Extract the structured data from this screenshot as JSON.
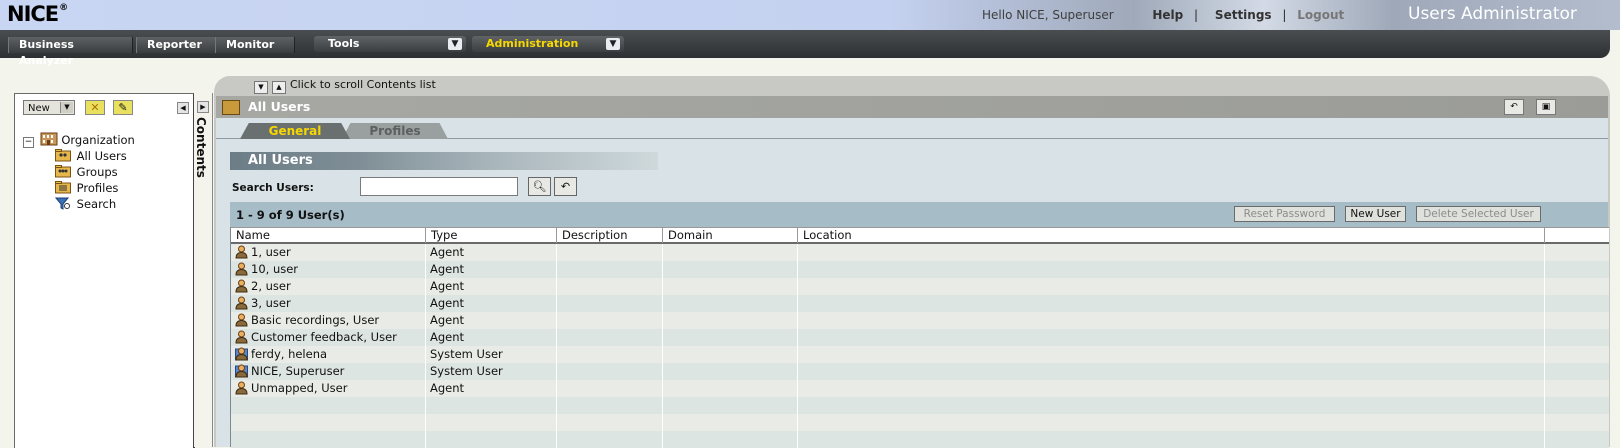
{
  "header": {
    "logo": "NICE",
    "logo_mark": "®",
    "greeting": "Hello NICE, Superuser",
    "links": [
      "Help",
      "Settings",
      "Logout"
    ],
    "app_title": "Users Administrator"
  },
  "nav": {
    "tabs": [
      "Business Analyzer",
      "Reporter",
      "Monitor"
    ],
    "tools_label": "Tools",
    "admin_label": "Administration"
  },
  "left": {
    "new_label": "New",
    "tree": [
      {
        "label": "Organization",
        "icon": "building-icon"
      },
      {
        "label": "All Users",
        "icon": "users-folder-icon"
      },
      {
        "label": "Groups",
        "icon": "groups-folder-icon"
      },
      {
        "label": "Profiles",
        "icon": "profiles-folder-icon"
      },
      {
        "label": "Search",
        "icon": "search-filter-icon"
      }
    ],
    "contents_label": "Contents"
  },
  "main": {
    "scroll_hint": "Click to scroll Contents list",
    "title": "All Users",
    "tabs": [
      "General",
      "Profiles"
    ],
    "section_title": "All Users",
    "search_label": "Search Users:",
    "search_value": "",
    "count_text": "1 - 9 of 9 User(s)",
    "buttons": {
      "reset": "Reset Password",
      "new_user": "New User",
      "delete": "Delete Selected User"
    },
    "columns": [
      "Name",
      "Type",
      "Description",
      "Domain",
      "Location"
    ],
    "rows": [
      {
        "name": "1, user",
        "type": "Agent",
        "description": "",
        "domain": "",
        "location": "",
        "icon": "agent-icon"
      },
      {
        "name": "10, user",
        "type": "Agent",
        "description": "",
        "domain": "",
        "location": "",
        "icon": "agent-icon"
      },
      {
        "name": "2, user",
        "type": "Agent",
        "description": "",
        "domain": "",
        "location": "",
        "icon": "agent-icon"
      },
      {
        "name": "3, user",
        "type": "Agent",
        "description": "",
        "domain": "",
        "location": "",
        "icon": "agent-icon"
      },
      {
        "name": "Basic recordings, User",
        "type": "Agent",
        "description": "",
        "domain": "",
        "location": "",
        "icon": "agent-icon"
      },
      {
        "name": "Customer feedback, User",
        "type": "Agent",
        "description": "",
        "domain": "",
        "location": "",
        "icon": "agent-icon"
      },
      {
        "name": "ferdy, helena",
        "type": "System User",
        "description": "",
        "domain": "",
        "location": "",
        "icon": "system-user-icon"
      },
      {
        "name": "NICE, Superuser",
        "type": "System User",
        "description": "",
        "domain": "",
        "location": "",
        "icon": "system-user-icon"
      },
      {
        "name": "Unmapped, User",
        "type": "Agent",
        "description": "",
        "domain": "",
        "location": "",
        "icon": "agent-icon"
      }
    ],
    "empty_rows": 3
  },
  "colors": {
    "accent_yellow": "#f6d800",
    "nav_dark": "#2d3032",
    "header_blue": "#c9d6f3"
  }
}
